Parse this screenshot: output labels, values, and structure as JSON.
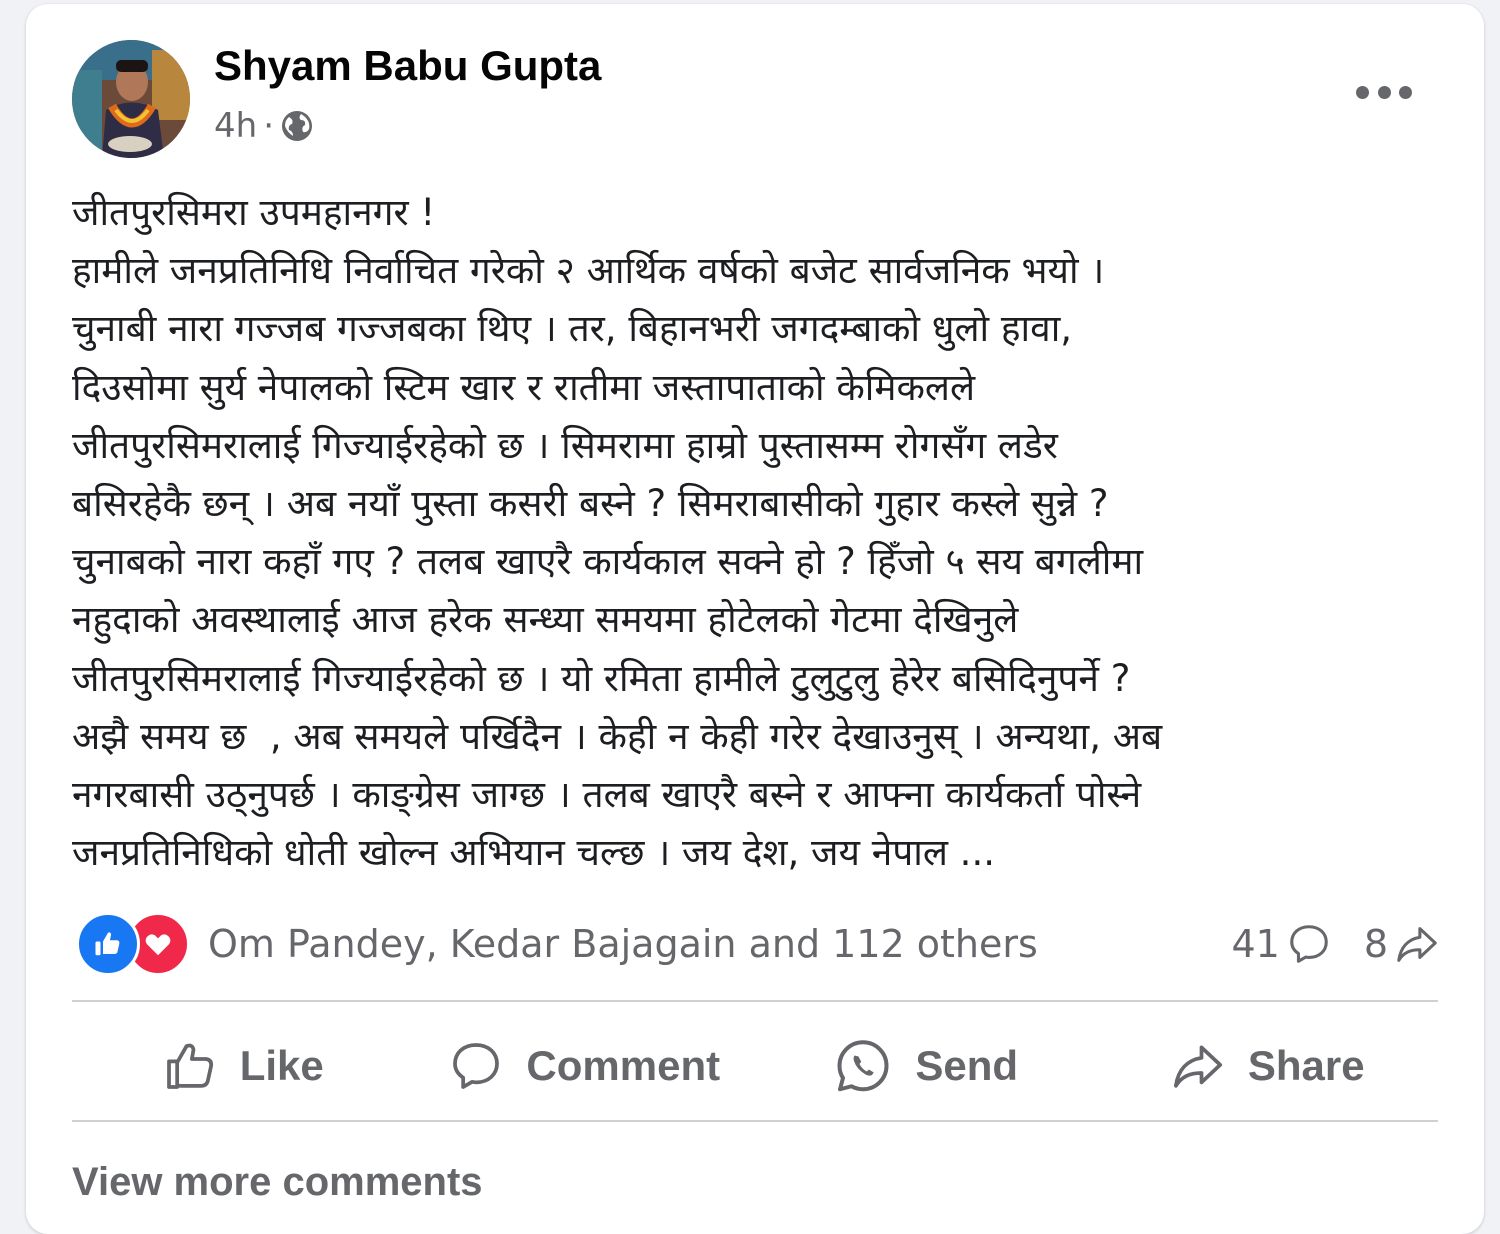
{
  "post": {
    "author": "Shyam Babu Gupta",
    "time": "4h",
    "separator": "·",
    "privacy_icon": "globe-icon",
    "more_icon": "more-options-icon",
    "text": "जीतपुरसिमरा उपमहानगर !\nहामीले जनप्रतिनिधि निर्वाचित गरेको २ आर्थिक वर्षको बजेट सार्वजनिक भयो ।\nचुनाबी नारा गज्जब गज्जबका थिए । तर, बिहानभरी जगदम्बाको धुलो हावा,\nदिउसोमा सुर्य नेपालको स्टिम खार र रातीमा जस्तापाताको केमिकलले\nजीतपुरसिमरालाई गिज्याईरहेको छ । सिमरामा हाम्रो पुस्तासम्म रोगसँग लडेर\nबसिरहेकै छन् । अब नयाँ पुस्ता कसरी बस्ने ? सिमराबासीको गुहार कस्ले सुन्ने ?\nचुनाबको नारा कहाँ गए ? तलब खाएरै कार्यकाल सक्ने हो ? हिँजो ५ सय बगलीमा\nनहुदाको अवस्थालाई आज हरेक सन्ध्या समयमा होटेलको गेटमा देखिनुले\nजीतपुरसिमरालाई गिज्याईरहेको छ । यो रमिता हामीले टुलुटुलु हेरेर बसिदिनुपर्ने ?\nअझै समय छ  , अब समयले पर्खिदैन । केही न केही गरेर देखाउनुस् । अन्यथा, अब\nनगरबासी उठ्नुपर्छ । काङ्ग्रेस जाग्छ । तलब खाएरै बस्ने र आफ्ना कार्यकर्ता पोस्ने\nजनप्रतिनिधिको धोती खोल्न अभियान चल्छ । जय देश, जय नेपाल ..."
  },
  "reactions": {
    "icons": [
      "like-reaction-icon",
      "love-reaction-icon"
    ],
    "summary": "Om Pandey, Kedar Bajagain and 112 others",
    "comments_count": "41",
    "shares_count": "8"
  },
  "actions": {
    "like": "Like",
    "comment": "Comment",
    "send": "Send",
    "share": "Share"
  },
  "footer": {
    "view_more": "View more comments"
  },
  "colors": {
    "background": "#f0f2f5",
    "card": "#ffffff",
    "secondary_text": "#65676b",
    "like_blue": "#1877f2",
    "love_red": "#f02849",
    "divider": "#ced0d4"
  }
}
